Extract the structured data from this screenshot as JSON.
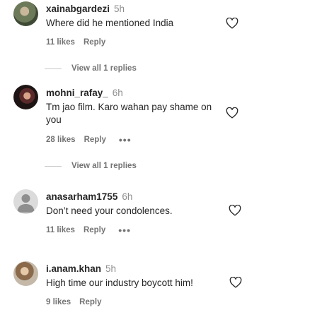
{
  "comments": [
    {
      "username": "xainabgardezi",
      "time": "5h",
      "text": "Where did he mentioned India",
      "likes": "11 likes",
      "reply": "Reply",
      "more": "",
      "view_replies": "View all 1 replies"
    },
    {
      "username": "mohni_rafay_",
      "time": "6h",
      "text": "Tm jao film. Karo wahan pay shame on you",
      "likes": "28 likes",
      "reply": "Reply",
      "more": "•••",
      "view_replies": "View all 1 replies"
    },
    {
      "username": "anasarham1755",
      "time": "6h",
      "text": "Don’t need your condolences.",
      "likes": "11 likes",
      "reply": "Reply",
      "more": "•••"
    },
    {
      "username": "i.anam.khan",
      "time": "5h",
      "text": "High time our industry boycott him!",
      "likes": "9 likes",
      "reply": "Reply"
    }
  ],
  "icons": {
    "like": "heart-outline-icon",
    "default_avatar": "person-silhouette-icon"
  },
  "colors": {
    "text": "#262626",
    "muted": "#737373",
    "time": "#8e8e8e"
  }
}
